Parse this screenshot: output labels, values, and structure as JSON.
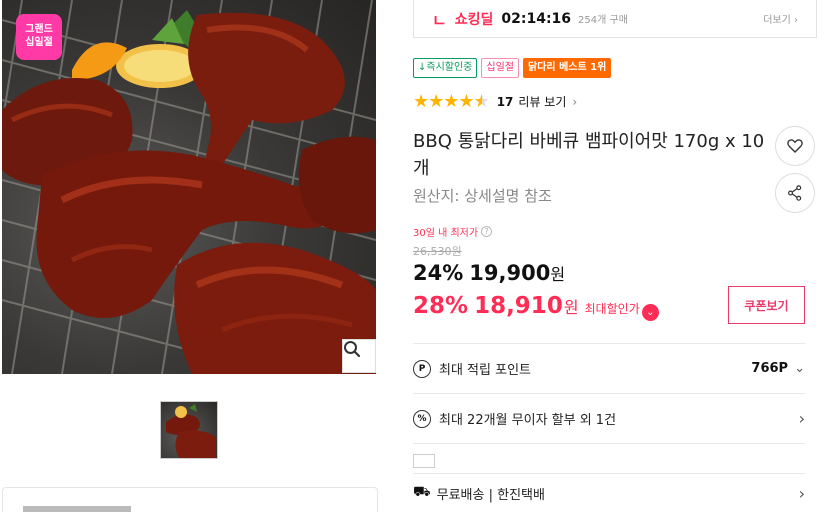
{
  "product_image": {
    "brand_badge": "그랜드\n십일절",
    "zoom_icon": "zoom-icon"
  },
  "thumbnail": {
    "count": 1
  },
  "shocking_deal": {
    "label": "쇼킹딜",
    "time_left": "02:14:16",
    "purchase_count": "254개 구매",
    "more_link": "더보기"
  },
  "badges": [
    {
      "label": "↓즉시할인중",
      "style": "green"
    },
    {
      "label": "십일절",
      "style": "pink"
    },
    {
      "label": "닭다리 베스트 1위",
      "style": "orange"
    }
  ],
  "rating": {
    "stars": 4.5,
    "review_count": "17",
    "review_link": "리뷰 보기"
  },
  "product": {
    "title": "BBQ 통닭다리 바베큐 뱀파이어맛 170g x 10개",
    "origin": "원산지: 상세설명 참조"
  },
  "price": {
    "lowest_label": "30일 내 최저가",
    "original": "26,530원",
    "sale_percent": "24%",
    "sale_price": "19,900",
    "won": "원",
    "max_percent": "28%",
    "max_price": "18,910",
    "max_label": "최대할인가",
    "coupon_button": "쿠폰보기"
  },
  "benefits": [
    {
      "icon": "P",
      "text": "최대 적립 포인트",
      "value": "766P"
    },
    {
      "icon": "%",
      "text": "최대 22개월 무이자 할부 외 1건"
    }
  ],
  "shipping": {
    "text": "무료배송 | 한진택배"
  },
  "colors": {
    "accent_red": "#ff2d55",
    "green": "#0a9b62",
    "orange": "#ff6a00",
    "star": "#ffb400",
    "badge_pink": "#ff3aa6"
  }
}
